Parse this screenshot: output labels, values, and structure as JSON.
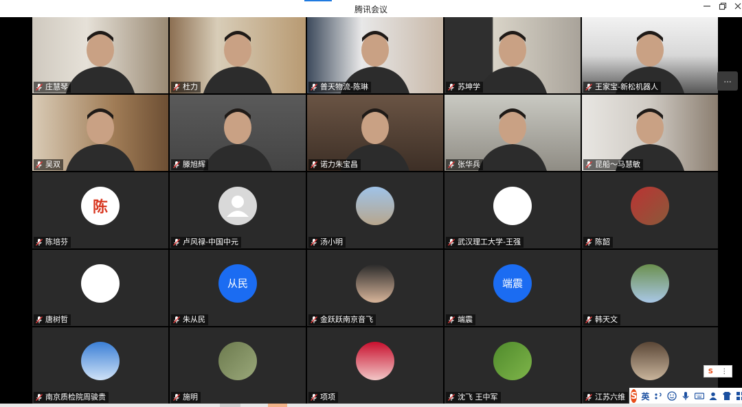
{
  "window": {
    "title": "腾讯会议",
    "minimize_icon": "minimize-icon",
    "maximize_icon": "maximize-icon",
    "close_icon": "close-icon"
  },
  "participants": [
    {
      "name": "庄慧琴",
      "kind": "video"
    },
    {
      "name": "杜力",
      "kind": "video"
    },
    {
      "name": "普天物流-陈琳",
      "kind": "video"
    },
    {
      "name": "苏坤学",
      "kind": "video"
    },
    {
      "name": "王家宝-新松机器人",
      "kind": "video"
    },
    {
      "name": "吴双",
      "kind": "video"
    },
    {
      "name": "滕旭辉",
      "kind": "video"
    },
    {
      "name": "诺力朱宝昌",
      "kind": "video"
    },
    {
      "name": "张华兵",
      "kind": "video"
    },
    {
      "name": "昆船～马慧敏",
      "kind": "video"
    },
    {
      "name": "陈培芬",
      "kind": "avatar",
      "avatar_text": "陈"
    },
    {
      "name": "卢风禄-中国中元",
      "kind": "avatar",
      "avatar_icon": "default-user-icon"
    },
    {
      "name": "汤小明",
      "kind": "avatar"
    },
    {
      "name": "武汉理工大学-王强",
      "kind": "avatar"
    },
    {
      "name": "陈韶",
      "kind": "avatar"
    },
    {
      "name": "唐树哲",
      "kind": "avatar"
    },
    {
      "name": "朱从民",
      "kind": "avatar",
      "avatar_text": "从民",
      "avatar_color": "#1b6cf2"
    },
    {
      "name": "金跃跃南京音飞",
      "kind": "avatar"
    },
    {
      "name": "端震",
      "kind": "avatar",
      "avatar_text": "端震",
      "avatar_color": "#1b6cf2"
    },
    {
      "name": "韩天文",
      "kind": "avatar"
    },
    {
      "name": "南京质检院周骏贵",
      "kind": "avatar"
    },
    {
      "name": "施明",
      "kind": "avatar"
    },
    {
      "name": "项项",
      "kind": "avatar"
    },
    {
      "name": "沈飞 王中军",
      "kind": "avatar"
    },
    {
      "name": "江苏六维",
      "kind": "avatar"
    }
  ],
  "side_handle": {
    "label": "..."
  },
  "ime": {
    "logo": "S",
    "mode": "英",
    "icons": [
      "punctuation-icon",
      "emoji-icon",
      "voice-icon",
      "keyboard-icon",
      "user-icon",
      "skin-icon",
      "toolbox-icon"
    ]
  },
  "colors": {
    "tile_bg": "#2a2a2a",
    "accent": "#1b6cf2",
    "mic_icon": "#ffffff"
  }
}
